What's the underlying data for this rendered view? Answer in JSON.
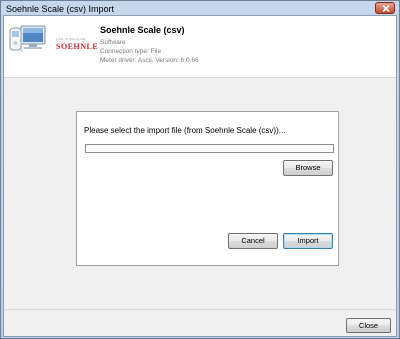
{
  "window": {
    "title": "Soehnle Scale (csv) Import"
  },
  "header": {
    "title": "Soehnle Scale (csv)",
    "line1": "Software",
    "line2": "Connection type: File",
    "line3": "Meter driver: Ascii, Version: 6.0.66",
    "logo_text": "SOEHNLE",
    "logo_tagline": "LIVE IN BALANCE"
  },
  "import_panel": {
    "prompt": "Please select the import file (from Soehnle Scale (csv))...",
    "file_path_value": "",
    "browse_label": "Browse",
    "cancel_label": "Cancel",
    "import_label": "Import"
  },
  "footer": {
    "close_label": "Close"
  },
  "icons": {
    "app_icon": "monitor-meter-icon",
    "close": "close-icon"
  },
  "colors": {
    "brand_red": "#c4282b",
    "focus_border": "#3c7fb1"
  }
}
